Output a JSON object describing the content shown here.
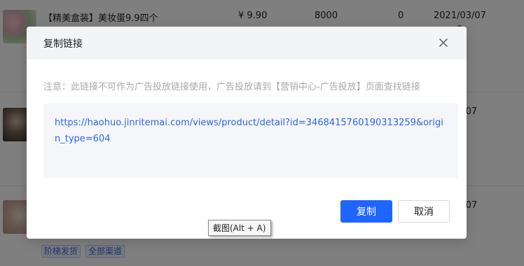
{
  "products": [
    {
      "title": "【精美盒装】美妆蛋9.9四个",
      "price": "¥ 9.90",
      "stock": "8000",
      "sales": "0",
      "date": "2021/03/07",
      "date_tail": "0"
    },
    {
      "title": "",
      "price": "",
      "stock": "",
      "sales": "",
      "date": "3/07",
      "date_tail": "3"
    },
    {
      "title": "",
      "price": "",
      "stock": "",
      "sales": "",
      "date": "3/07",
      "date_tail": "0"
    }
  ],
  "tags": [
    "阶梯发货",
    "全部渠道"
  ],
  "modal": {
    "title": "复制链接",
    "notice": "注意：此链接不可作为广告投放链接使用，广告投放请到【营销中心-广告投放】页面查找链接",
    "url": "https://haohuo.jinritemai.com/views/product/detail?id=3468415760190313259&origin_type=604",
    "copy_label": "复制",
    "cancel_label": "取消"
  },
  "tooltip": "截图(Alt + A)",
  "colors": {
    "primary": "#1f65ff",
    "link": "#2a68e8",
    "mask": "rgba(0,0,0,0.5)"
  },
  "icons": {
    "close": "close-icon"
  }
}
